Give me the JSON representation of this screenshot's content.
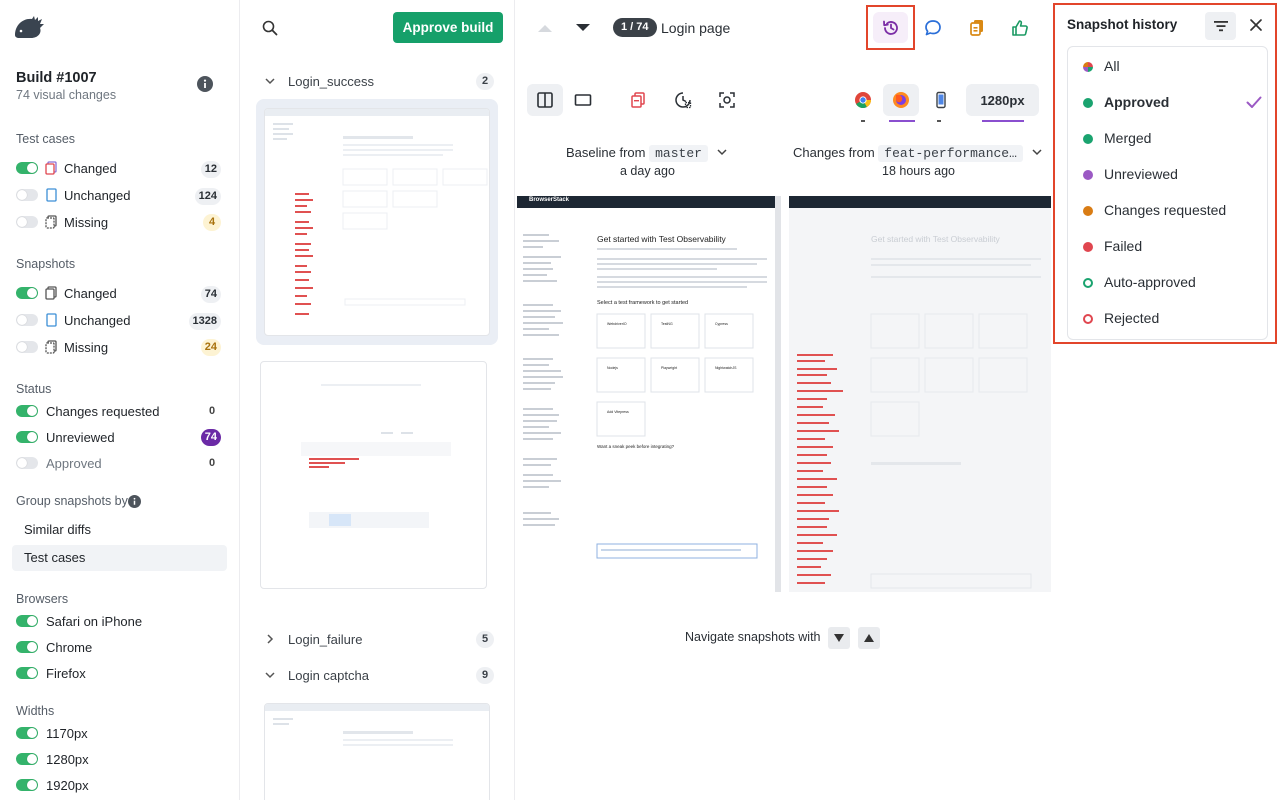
{
  "build": {
    "title": "Build #1007",
    "subtitle": "74 visual changes"
  },
  "sidebar": {
    "test_cases": {
      "title": "Test cases",
      "items": [
        {
          "label": "Changed",
          "count": "12",
          "on": true
        },
        {
          "label": "Unchanged",
          "count": "124",
          "on": false
        },
        {
          "label": "Missing",
          "count": "4",
          "on": false
        }
      ]
    },
    "snapshots": {
      "title": "Snapshots",
      "items": [
        {
          "label": "Changed",
          "count": "74",
          "on": true
        },
        {
          "label": "Unchanged",
          "count": "1328",
          "on": false
        },
        {
          "label": "Missing",
          "count": "24",
          "on": false
        }
      ]
    },
    "status": {
      "title": "Status",
      "items": [
        {
          "label": "Changes requested",
          "count": "0",
          "on": true
        },
        {
          "label": "Unreviewed",
          "count": "74",
          "on": true
        },
        {
          "label": "Approved",
          "count": "0",
          "on": false
        }
      ]
    },
    "group_by": {
      "title": "Group snapshots by",
      "options": [
        "Similar diffs",
        "Test cases"
      ],
      "selected": "Test cases"
    },
    "browsers": {
      "title": "Browsers",
      "items": [
        "Safari on iPhone",
        "Chrome",
        "Firefox"
      ]
    },
    "widths": {
      "title": "Widths",
      "items": [
        "1170px",
        "1280px",
        "1920px"
      ]
    }
  },
  "list": {
    "approve_label": "Approve build",
    "groups": [
      {
        "name": "Login_success",
        "count": "2",
        "expanded": true
      },
      {
        "name": "Login_failure",
        "count": "5",
        "expanded": false
      },
      {
        "name": "Login captcha",
        "count": "9",
        "expanded": true
      }
    ]
  },
  "main": {
    "position": "1 / 74",
    "snapshot_name": "Login page",
    "width_label": "1280px",
    "baseline": {
      "prefix": "Baseline from",
      "branch": "master",
      "time": "a day ago"
    },
    "changes": {
      "prefix": "Changes from",
      "branch": "feat-performance…",
      "time": "18 hours ago"
    },
    "navigate_label": "Navigate snapshots with",
    "preview": {
      "brand": "BrowserStack",
      "heading": "Get started with Test Observability",
      "subheading": "Select a test framework to get started",
      "frameworks": [
        "WebdriverIO",
        "TestNG",
        "Cypress",
        "Nodejs",
        "Playwright",
        "NightwatchJS",
        "Add Vitepress"
      ],
      "footer": "Want a sneak peek before integrating?"
    }
  },
  "history": {
    "title": "Snapshot history",
    "selected": "Approved",
    "items": [
      {
        "label": "All",
        "color": "multi",
        "style": "fill"
      },
      {
        "label": "Approved",
        "color": "#1aa36f",
        "style": "fill"
      },
      {
        "label": "Merged",
        "color": "#1aa36f",
        "style": "fill"
      },
      {
        "label": "Unreviewed",
        "color": "#9b59c4",
        "style": "fill"
      },
      {
        "label": "Changes requested",
        "color": "#d97c14",
        "style": "fill"
      },
      {
        "label": "Failed",
        "color": "#e0464f",
        "style": "fill"
      },
      {
        "label": "Auto-approved",
        "color": "#1aa36f",
        "style": "ring"
      },
      {
        "label": "Rejected",
        "color": "#e0464f",
        "style": "ring"
      }
    ]
  },
  "colors": {
    "accent": "#16a06a",
    "highlight": "#e2452b",
    "toggle_on": "#34b36b"
  }
}
